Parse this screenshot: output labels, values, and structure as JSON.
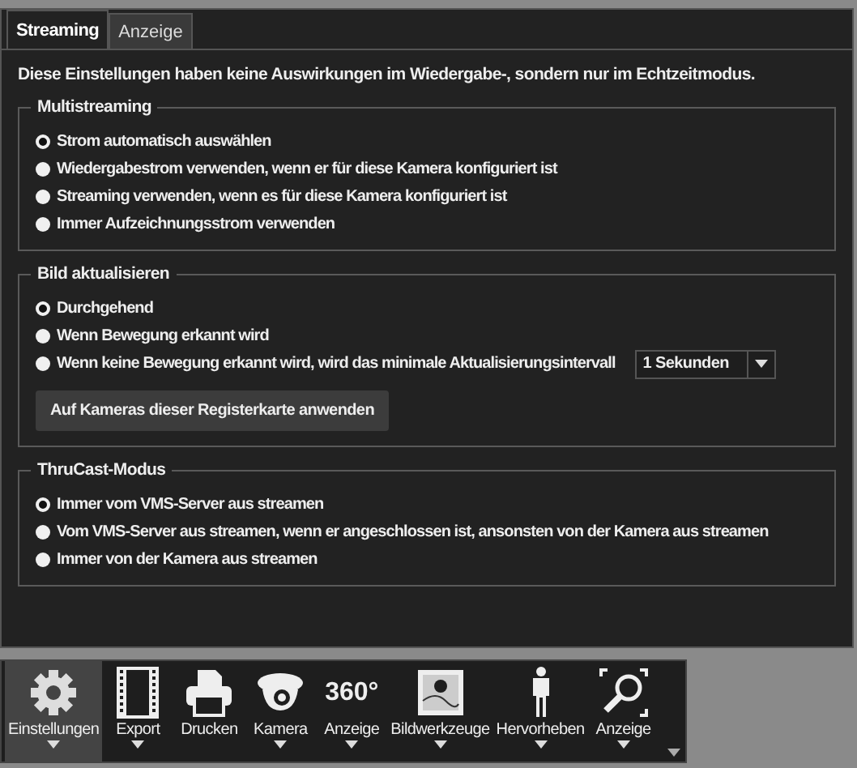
{
  "tabs": [
    {
      "label": "Streaming",
      "selected": true
    },
    {
      "label": "Anzeige",
      "selected": false
    }
  ],
  "notice": "Diese Einstellungen haben keine Auswirkungen im Wiedergabe-, sondern nur im Echtzeitmodus.",
  "groups": [
    {
      "title": "Multistreaming",
      "options": [
        {
          "label": "Strom automatisch auswählen",
          "selected": true
        },
        {
          "label": "Wiedergabestrom verwenden, wenn er für diese Kamera konfiguriert ist",
          "selected": false
        },
        {
          "label": "Streaming verwenden, wenn es für diese Kamera konfiguriert ist",
          "selected": false
        },
        {
          "label": "Immer Aufzeichnungsstrom verwenden",
          "selected": false
        }
      ]
    },
    {
      "title": "Bild aktualisieren",
      "options": [
        {
          "label": "Durchgehend",
          "selected": true
        },
        {
          "label": "Wenn Bewegung erkannt wird",
          "selected": false
        },
        {
          "label": "Wenn keine Bewegung erkannt wird, wird das minimale Aktualisierungsintervall",
          "selected": false,
          "dropdown": "1 Sekunden"
        }
      ],
      "button": "Auf Kameras dieser Registerkarte anwenden"
    },
    {
      "title": "ThruCast-Modus",
      "options": [
        {
          "label": "Immer vom VMS-Server aus streamen",
          "selected": true
        },
        {
          "label": "Vom VMS-Server aus streamen, wenn er angeschlossen ist, ansonsten von der Kamera aus streamen",
          "selected": false
        },
        {
          "label": "Immer von der Kamera aus streamen",
          "selected": false
        }
      ]
    }
  ],
  "toolbar": [
    {
      "kind": "gear",
      "label": "Einstellungen",
      "has_menu": true,
      "selected": true
    },
    {
      "kind": "film",
      "label": "Export",
      "has_menu": true,
      "selected": false
    },
    {
      "kind": "printer",
      "label": "Drucken",
      "has_menu": false,
      "selected": false
    },
    {
      "kind": "camera",
      "label": "Kamera",
      "has_menu": true,
      "selected": false
    },
    {
      "kind": "text",
      "icon_text": "360°",
      "label": "Anzeige",
      "has_menu": true,
      "selected": false
    },
    {
      "kind": "picture",
      "label": "Bildwerkzeuge",
      "has_menu": true,
      "selected": false
    },
    {
      "kind": "person",
      "label": "Hervorheben",
      "has_menu": true,
      "selected": false
    },
    {
      "kind": "zoom",
      "label": "Anzeige",
      "has_menu": true,
      "selected": false
    }
  ]
}
